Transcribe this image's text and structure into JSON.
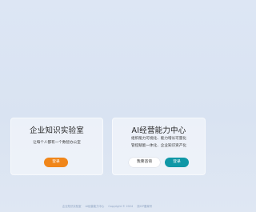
{
  "cards": [
    {
      "title": "企业知识实验室",
      "description": "让每个人都有一个数智办公室",
      "login_label": "登录"
    },
    {
      "title": "AI经营能力中心",
      "description_lines": [
        "组织能力可视化、能力增长可量化",
        "管控赋能一体化、企业知识资产化"
      ],
      "apply_label": "我要咨询",
      "login_label": "登录"
    }
  ],
  "footer": {
    "links": [
      "企业知识实验室",
      "AI经营能力中心",
      "Copyright © 2024",
      "浙ICP备案号"
    ]
  },
  "colors": {
    "background": "#dde6f4",
    "card_background": "#f0f4fa",
    "login_orange": "#f0861a",
    "login_teal": "#0f97a6",
    "footer_text": "#8ea3c2"
  }
}
